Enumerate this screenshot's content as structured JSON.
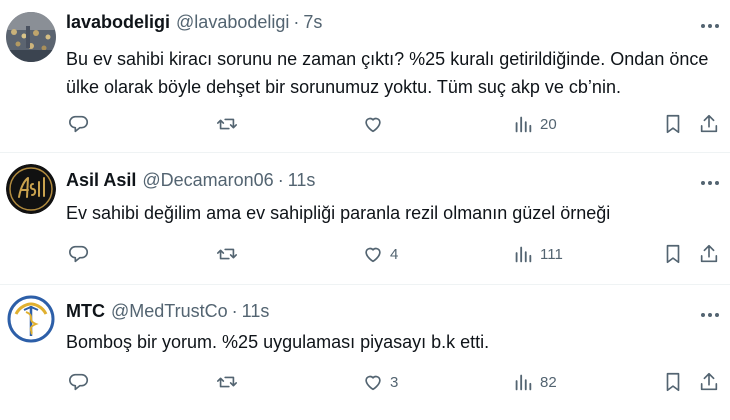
{
  "posts": [
    {
      "display_name": "lavabodeligi",
      "handle": "@lavabodeligi",
      "separator": "·",
      "time": "7s",
      "text": "Bu ev sahibi kiracı sorunu ne zaman çıktı? %25 kuralı getirildiğinde. Ondan önce ülke olarak böyle dehşet bir sorunumuz yoktu.  Tüm suç akp ve cb’nin.",
      "likes": "",
      "views": "20"
    },
    {
      "display_name": "Asil Asil",
      "handle": "@Decamaron06",
      "separator": "·",
      "time": "11s",
      "text": "Ev sahibi değilim ama ev sahipliği paranla rezil olmanın güzel örneği",
      "likes": "4",
      "views": "111"
    },
    {
      "display_name": "MTC",
      "handle": "@MedTrustCo",
      "separator": "·",
      "time": "11s",
      "text": "Bomboş bir yorum. %25 uygulaması piyasayı b.k etti.",
      "likes": "3",
      "views": "82"
    }
  ],
  "icons": {
    "more": "more-horizontal-icon",
    "reply": "reply-icon",
    "retweet": "retweet-icon",
    "like": "heart-icon",
    "views": "views-chart-icon",
    "bookmark": "bookmark-icon",
    "share": "share-icon"
  },
  "colors": {
    "text_primary": "#0f1419",
    "text_secondary": "#536471",
    "divider": "#eff3f4"
  }
}
